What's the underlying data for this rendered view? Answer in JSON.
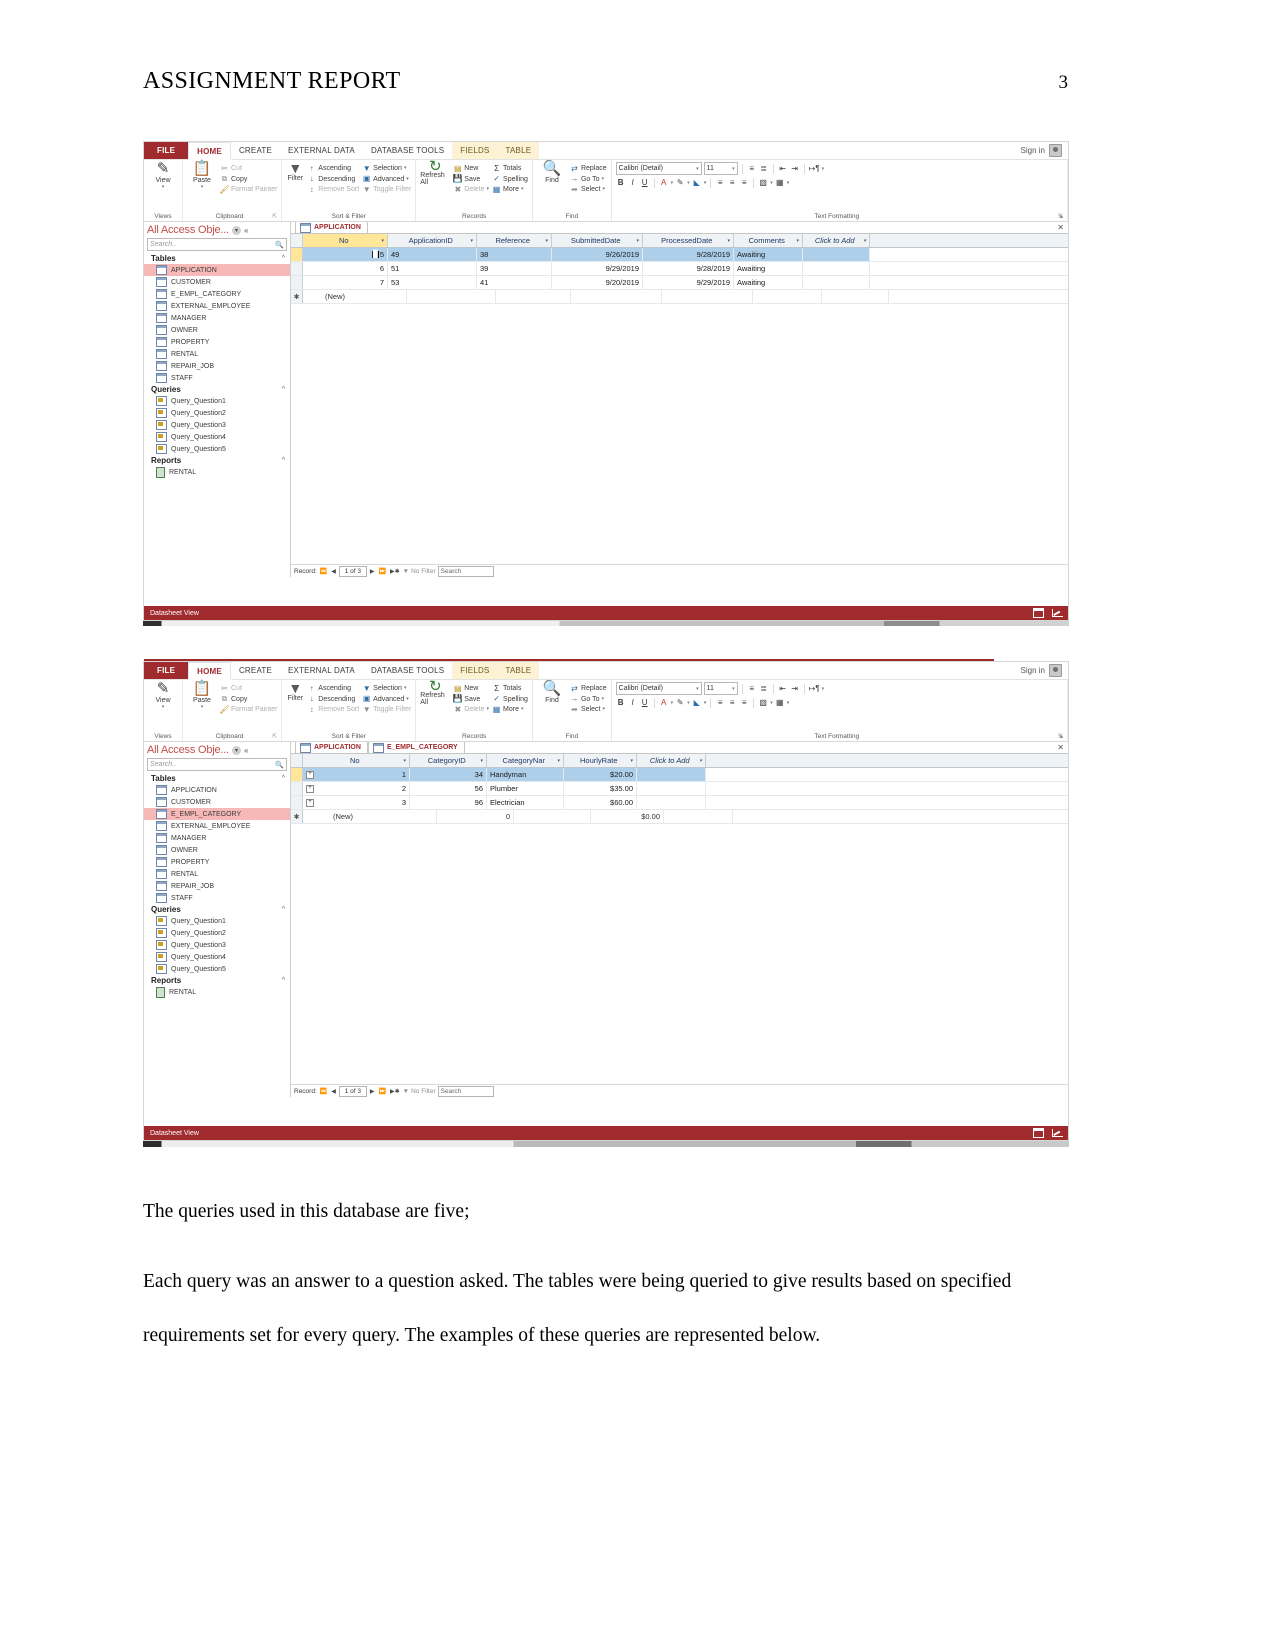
{
  "document": {
    "title": "ASSIGNMENT REPORT",
    "page_number": "3",
    "paragraph_1": "The queries used in this database are five;",
    "paragraph_2": "Each query was an answer to a question asked. The tables were being queried to give results based on specified requirements set for every query. The examples of these queries are represented below."
  },
  "colors": {
    "accent_red": "#a02b2f",
    "nav_selected": "#f7b9b7",
    "row_selected": "#aecfe9",
    "key_column": "#ffe699",
    "context_tab": "#fdf3d4"
  },
  "ribbon": {
    "tabs": [
      {
        "label": "FILE",
        "kind": "file"
      },
      {
        "label": "HOME",
        "kind": "active"
      },
      {
        "label": "CREATE",
        "kind": "normal"
      },
      {
        "label": "EXTERNAL DATA",
        "kind": "normal"
      },
      {
        "label": "DATABASE TOOLS",
        "kind": "normal"
      },
      {
        "label": "FIELDS",
        "kind": "context"
      },
      {
        "label": "TABLE",
        "kind": "context"
      }
    ],
    "sign_in": "Sign in",
    "groups": {
      "views": {
        "label": "Views",
        "view_button": "View"
      },
      "clipboard": {
        "label": "Clipboard",
        "paste": "Paste",
        "cut": "Cut",
        "copy": "Copy",
        "format_painter": "Format Painter"
      },
      "sort_filter": {
        "label": "Sort & Filter",
        "filter": "Filter",
        "ascending": "Ascending",
        "descending": "Descending",
        "remove_sort": "Remove Sort",
        "selection": "Selection",
        "advanced": "Advanced",
        "toggle_filter": "Toggle Filter"
      },
      "records": {
        "label": "Records",
        "refresh_all": "Refresh All",
        "new": "New",
        "save": "Save",
        "delete": "Delete",
        "totals": "Totals",
        "spelling": "Spelling",
        "more": "More"
      },
      "find": {
        "label": "Find",
        "find": "Find",
        "replace": "Replace",
        "go_to": "Go To",
        "select": "Select"
      },
      "text_formatting": {
        "label": "Text Formatting",
        "font_name": "Calibri (Detail)",
        "font_size": "11",
        "bold": "B",
        "italic": "I",
        "underline": "U"
      }
    }
  },
  "nav_pane": {
    "title": "All Access Obje...",
    "search_placeholder": "Search..",
    "groups": [
      {
        "name": "Tables",
        "items": [
          "APPLICATION",
          "CUSTOMER",
          "E_EMPL_CATEGORY",
          "EXTERNAL_EMPLOYEE",
          "MANAGER",
          "OWNER",
          "PROPERTY",
          "RENTAL",
          "REPAIR_JOB",
          "STAFF"
        ]
      },
      {
        "name": "Queries",
        "items": [
          "Query_Question1",
          "Query_Question2",
          "Query_Question3",
          "Query_Question4",
          "Query_Question5"
        ]
      },
      {
        "name": "Reports",
        "items": [
          "RENTAL"
        ]
      }
    ]
  },
  "window1": {
    "selected_nav_item": "APPLICATION",
    "doc_tabs": [
      "APPLICATION"
    ],
    "table": {
      "columns": [
        "No",
        "ApplicationID",
        "Reference",
        "SubmittedDate",
        "ProcessedDate",
        "Comments",
        "Click to Add"
      ],
      "rows": [
        {
          "no": "5",
          "application_id": "49",
          "reference": "38",
          "submitted": "9/26/2019",
          "processed": "9/28/2019",
          "comments": "Awaiting",
          "selected": true
        },
        {
          "no": "6",
          "application_id": "51",
          "reference": "39",
          "submitted": "9/29/2019",
          "processed": "9/28/2019",
          "comments": "Awaiting",
          "selected": false
        },
        {
          "no": "7",
          "application_id": "53",
          "reference": "41",
          "submitted": "9/20/2019",
          "processed": "9/29/2019",
          "comments": "Awaiting",
          "selected": false
        }
      ],
      "new_row_label": "(New)"
    },
    "record_nav": {
      "label": "Record:",
      "position": "1 of 3",
      "filter_status": "No Filter",
      "search_placeholder": "Search"
    },
    "status": "Datasheet View"
  },
  "window2": {
    "selected_nav_item": "E_EMPL_CATEGORY",
    "doc_tabs": [
      "APPLICATION",
      "E_EMPL_CATEGORY"
    ],
    "table": {
      "columns": [
        "No",
        "CategoryID",
        "CategoryNar",
        "HourlyRate",
        "Click to Add"
      ],
      "rows": [
        {
          "no": "1",
          "category_id": "34",
          "category_name": "Handyman",
          "hourly_rate": "$20.00",
          "selected": true
        },
        {
          "no": "2",
          "category_id": "56",
          "category_name": "Plumber",
          "hourly_rate": "$35.00",
          "selected": false
        },
        {
          "no": "3",
          "category_id": "96",
          "category_name": "Electrician",
          "hourly_rate": "$60.00",
          "selected": false
        }
      ],
      "new_row": {
        "no": "(New)",
        "category_id": "0",
        "category_name": "",
        "hourly_rate": "$0.00"
      }
    },
    "record_nav": {
      "label": "Record:",
      "position": "1 of 3",
      "filter_status": "No Filter",
      "search_placeholder": "Search"
    },
    "status": "Datasheet View"
  }
}
